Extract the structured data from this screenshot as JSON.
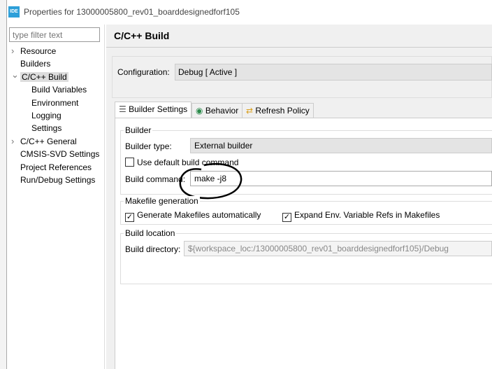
{
  "window": {
    "title": "Properties for 13000005800_rev01_boarddesignedforf105",
    "icon_text": "IDE",
    "accent": "#2d9fd9"
  },
  "sidebar": {
    "filter_placeholder": "type filter text",
    "items": [
      {
        "label": "Resource",
        "chevron": ">",
        "level": 0
      },
      {
        "label": "Builders",
        "chevron": "",
        "level": 0
      },
      {
        "label": "C/C++ Build",
        "chevron": "v",
        "level": 0,
        "selected": true
      },
      {
        "label": "Build Variables",
        "chevron": "",
        "level": 1
      },
      {
        "label": "Environment",
        "chevron": "",
        "level": 1
      },
      {
        "label": "Logging",
        "chevron": "",
        "level": 1
      },
      {
        "label": "Settings",
        "chevron": "",
        "level": 1
      },
      {
        "label": "C/C++ General",
        "chevron": ">",
        "level": 0
      },
      {
        "label": "CMSIS-SVD Settings",
        "chevron": "",
        "level": 0
      },
      {
        "label": "Project References",
        "chevron": "",
        "level": 0
      },
      {
        "label": "Run/Debug Settings",
        "chevron": "",
        "level": 0
      }
    ]
  },
  "main": {
    "title": "C/C++ Build",
    "configuration_label": "Configuration:",
    "configuration_value": "Debug  [ Active ]",
    "tabs": [
      {
        "label": "Builder Settings",
        "icon": "list-icon",
        "active": true
      },
      {
        "label": "Behavior",
        "icon": "radio-icon"
      },
      {
        "label": "Refresh Policy",
        "icon": "refresh-icon"
      }
    ],
    "builder": {
      "group": "Builder",
      "type_label": "Builder type:",
      "type_value": "External builder",
      "use_default_label": "Use default build command",
      "use_default_checked": false,
      "command_label": "Build command:",
      "command_value": "make -j8"
    },
    "makefile": {
      "group": "Makefile generation",
      "generate_label": "Generate Makefiles automatically",
      "generate_checked": true,
      "expand_label": "Expand Env. Variable Refs in Makefiles",
      "expand_checked": true
    },
    "location": {
      "group": "Build location",
      "dir_label": "Build directory:",
      "dir_value": "${workspace_loc:/13000005800_rev01_boarddesignedforf105}/Debug"
    }
  }
}
